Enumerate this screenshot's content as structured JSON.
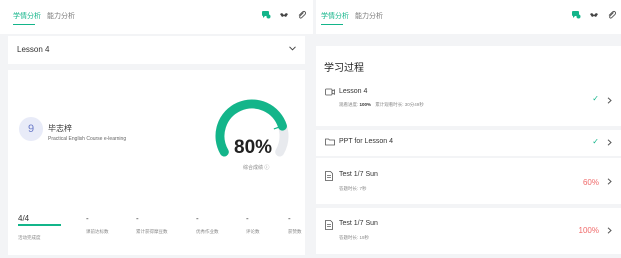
{
  "left": {
    "tabs": [
      {
        "label": "学情分析",
        "active": true
      },
      {
        "label": "能力分析",
        "active": false
      }
    ],
    "lesson_select": {
      "value": "Lesson 4"
    },
    "student": {
      "avatar": "9",
      "name": "毕志梓",
      "course": "Practical English Course e-learning"
    },
    "gauge": {
      "value": "80%",
      "label": "综合成绩 ⓘ",
      "percent": 80
    },
    "stats": [
      {
        "value": "4/4",
        "label": "活动完成度",
        "progress": 1.0
      },
      {
        "value": "-",
        "label": "课前达标数"
      },
      {
        "value": "-",
        "label": "累计获得摩豆数"
      },
      {
        "value": "-",
        "label": "优秀作业数"
      },
      {
        "value": "-",
        "label": "评论数"
      },
      {
        "value": "-",
        "label": "获赞数"
      }
    ]
  },
  "right": {
    "tabs": [
      {
        "label": "学情分析",
        "active": true
      },
      {
        "label": "能力分析",
        "active": false
      }
    ],
    "section_title": "学习过程",
    "items": [
      {
        "icon": "video-icon",
        "name": "Lesson 4",
        "sub_label": "观看进度:",
        "sub_value": "100%",
        "sub_extra": "累计观看时长: 30分49秒",
        "status": "✓",
        "status_type": "check"
      },
      {
        "icon": "folder-icon",
        "name": "PPT for Lesson 4",
        "status": "✓",
        "status_type": "check"
      },
      {
        "icon": "doc-icon",
        "name": "Test 1/7 Sun",
        "sub_extra": "答题时长: 7秒",
        "status": "60%",
        "status_type": "score"
      },
      {
        "icon": "doc-icon",
        "name": "Test 1/7 Sun",
        "sub_extra": "答题时长: 19秒",
        "status": "100%",
        "status_type": "score"
      }
    ]
  },
  "colors": {
    "accent": "#13b58a",
    "score_red": "#f06a6a"
  }
}
